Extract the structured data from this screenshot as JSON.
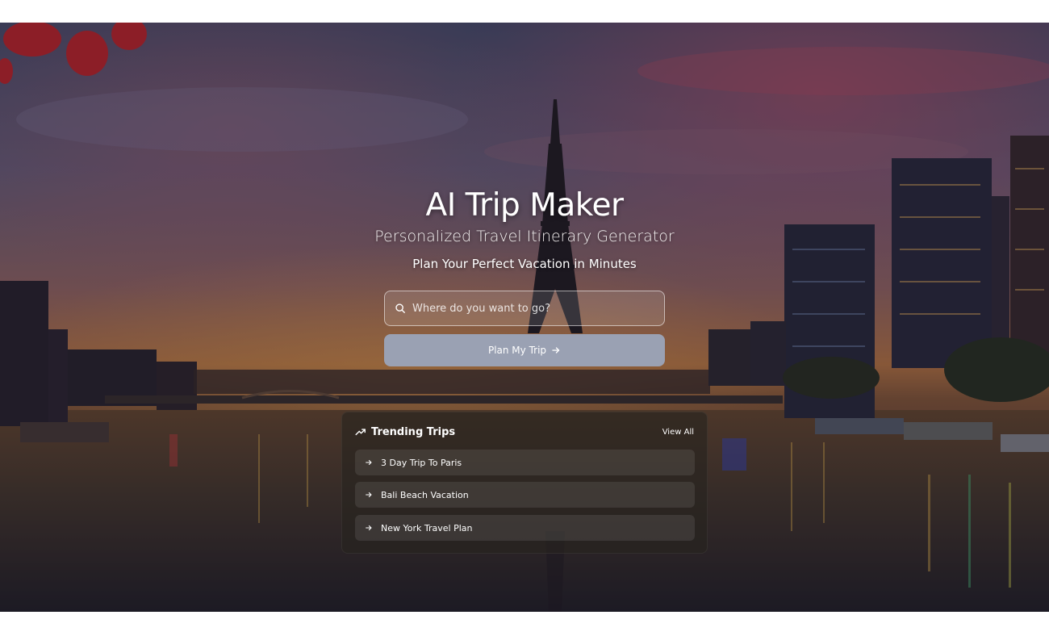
{
  "hero": {
    "title": "AI Trip Maker",
    "subtitle": "Personalized Travel Itinerary Generator",
    "tagline": "Plan Your Perfect Vacation in Minutes"
  },
  "search": {
    "icon": "search-icon",
    "placeholder": "Where do you want to go?",
    "value": ""
  },
  "plan_button": {
    "label": "Plan My Trip",
    "icon": "arrow-right-icon"
  },
  "trending": {
    "icon": "trending-up-icon",
    "title": "Trending Trips",
    "view_all": "View All",
    "items": [
      {
        "label": "3 Day Trip To Paris",
        "icon": "arrow-right-icon"
      },
      {
        "label": "Bali Beach Vacation",
        "icon": "arrow-right-icon"
      },
      {
        "label": "New York Travel Plan",
        "icon": "arrow-right-icon"
      }
    ]
  },
  "colors": {
    "button": "#9aa1b3",
    "panel": "#26241e",
    "text": "#ffffff"
  }
}
